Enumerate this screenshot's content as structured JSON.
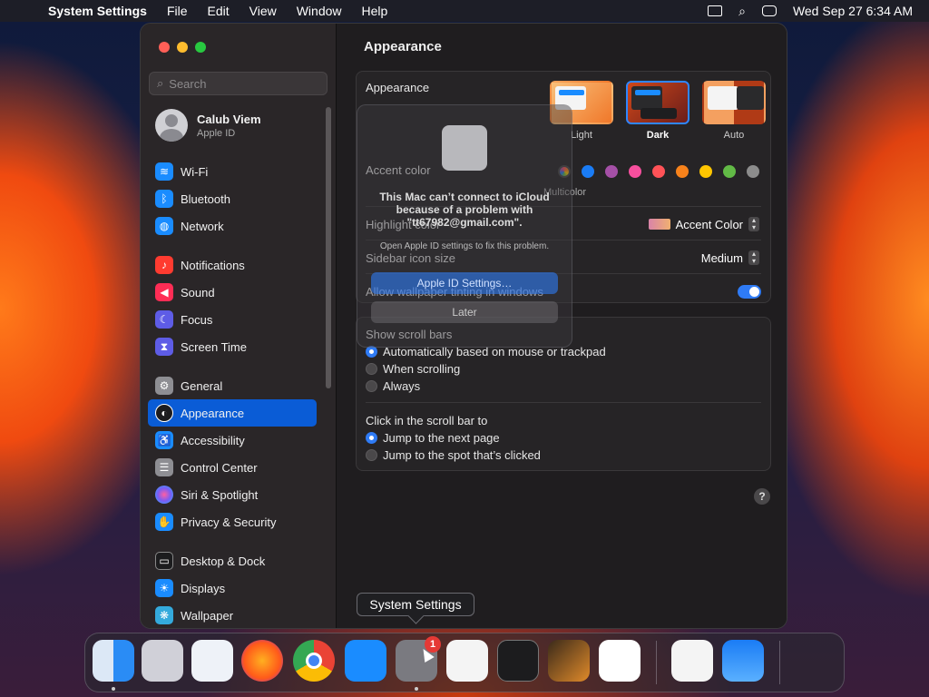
{
  "menubar": {
    "app": "System Settings",
    "items": [
      "File",
      "Edit",
      "View",
      "Window",
      "Help"
    ],
    "datetime": "Wed Sep 27  6:34 AM"
  },
  "sidebar": {
    "search_placeholder": "Search",
    "account": {
      "name": "Calub Viem",
      "subtitle": "Apple ID"
    },
    "items": [
      {
        "label": "Wi-Fi",
        "icon": "wifi-icon",
        "color": "#1a8cff"
      },
      {
        "label": "Bluetooth",
        "icon": "bluetooth-icon",
        "color": "#1a8cff"
      },
      {
        "label": "Network",
        "icon": "globe-icon",
        "color": "#1a8cff"
      },
      {
        "label": "Notifications",
        "icon": "bell-icon",
        "color": "#ff3b30"
      },
      {
        "label": "Sound",
        "icon": "speaker-icon",
        "color": "#ff2d55"
      },
      {
        "label": "Focus",
        "icon": "moon-icon",
        "color": "#5e5ce6"
      },
      {
        "label": "Screen Time",
        "icon": "hourglass-icon",
        "color": "#5e5ce6"
      },
      {
        "label": "General",
        "icon": "gear-icon",
        "color": "#8e8e93"
      },
      {
        "label": "Appearance",
        "icon": "appearance-icon",
        "color": "#1c1c1e"
      },
      {
        "label": "Accessibility",
        "icon": "accessibility-icon",
        "color": "#1a8cff"
      },
      {
        "label": "Control Center",
        "icon": "control-center-icon",
        "color": "#8e8e93"
      },
      {
        "label": "Siri & Spotlight",
        "icon": "siri-icon",
        "color": "#bf5af2"
      },
      {
        "label": "Privacy & Security",
        "icon": "hand-icon",
        "color": "#1a8cff"
      },
      {
        "label": "Desktop & Dock",
        "icon": "dock-icon",
        "color": "#1c1c1e"
      },
      {
        "label": "Displays",
        "icon": "sun-icon",
        "color": "#1a8cff"
      },
      {
        "label": "Wallpaper",
        "icon": "snowflake-icon",
        "color": "#34aadc"
      }
    ],
    "active": "Appearance"
  },
  "content": {
    "title": "Appearance",
    "appearance": {
      "label": "Appearance",
      "options": [
        "Light",
        "Dark",
        "Auto"
      ],
      "selected": "Dark"
    },
    "accent": {
      "label": "Accent color",
      "colors": [
        "#8e8e93",
        "#1a7cf5",
        "#a550a7",
        "#f74f9e",
        "#ff5257",
        "#f7821b",
        "#ffc600",
        "#62ba46",
        "#8c8c8c"
      ],
      "multicolor_label": "Multicolor"
    },
    "highlight": {
      "label": "Highlight color",
      "value": "Accent Color"
    },
    "sidebar_icon_size": {
      "label": "Sidebar icon size",
      "value": "Medium"
    },
    "tinting": {
      "label": "Allow wallpaper tinting in windows",
      "enabled": true
    },
    "scroll_bars": {
      "label": "Show scroll bars",
      "options": [
        "Automatically based on mouse or trackpad",
        "When scrolling",
        "Always"
      ],
      "selected": 0
    },
    "click_scroll": {
      "label": "Click in the scroll bar to",
      "options": [
        "Jump to the next page",
        "Jump to the spot that’s clicked"
      ],
      "selected": 0
    },
    "help": "?"
  },
  "alert": {
    "title": "This Mac can’t connect to iCloud because of a problem with \"tt67982@gmail.com\".",
    "message": "Open Apple ID settings to fix this problem.",
    "primary": "Apple ID Settings…",
    "secondary": "Later"
  },
  "tooltip": "System Settings",
  "dock": {
    "items": [
      {
        "name": "finder-icon",
        "color": "#2a8cf5",
        "glyph": "☺"
      },
      {
        "name": "launchpad-icon",
        "color": "#d0d0d8",
        "glyph": "▦"
      },
      {
        "name": "safari-icon",
        "color": "#eef2f8",
        "glyph": "◎"
      },
      {
        "name": "firefox-icon",
        "color": "#ff7a1a",
        "glyph": "◉"
      },
      {
        "name": "chrome-icon",
        "color": "#f4f4f4",
        "glyph": "◉"
      },
      {
        "name": "app-store-icon",
        "color": "#1a8cff",
        "glyph": "A"
      },
      {
        "name": "system-settings-icon",
        "color": "#7a7a80",
        "glyph": "⚙"
      },
      {
        "name": "textedit-icon",
        "color": "#f4f4f4",
        "glyph": "✎"
      },
      {
        "name": "terminal-icon",
        "color": "#1c1c1e",
        "glyph": ">_"
      },
      {
        "name": "garageband-icon",
        "color": "#e08a2a",
        "glyph": "♫"
      },
      {
        "name": "vscode-icon",
        "color": "#ffffff",
        "glyph": "≺"
      },
      {
        "name": "visual-studio-icon",
        "color": "#f4f4f4",
        "glyph": "◢"
      },
      {
        "name": "weather-icon",
        "color": "#1a8cff",
        "glyph": "☁"
      },
      {
        "name": "trash-icon",
        "color": "#6c6c70",
        "glyph": "▥"
      }
    ],
    "settings_badge": "1"
  }
}
